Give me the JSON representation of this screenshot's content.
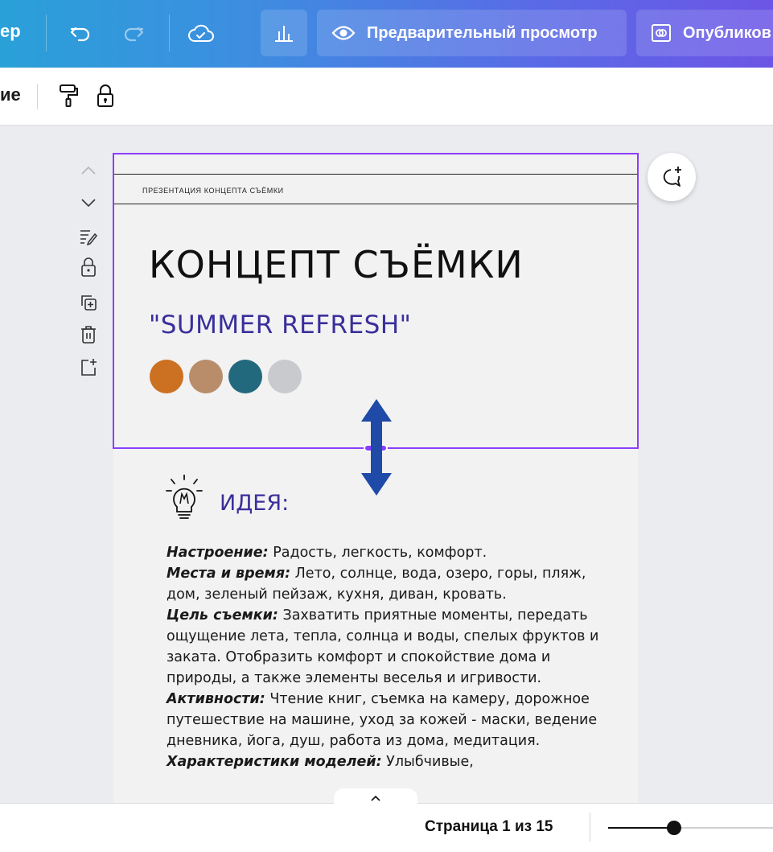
{
  "topbar": {
    "left_fragment": "ер",
    "preview_label": "Предварительный просмотр",
    "publish_label": "Опубликов",
    "icons": [
      "undo-icon",
      "redo-icon",
      "cloud-saved-icon",
      "insights-icon",
      "eye-icon",
      "publish-icon"
    ]
  },
  "toolbar": {
    "left_fragment": "ие",
    "icons": [
      "paint-roller-icon",
      "lock-icon"
    ]
  },
  "page_controls": [
    "chevron-up-icon",
    "chevron-down-icon",
    "notes-icon",
    "lock-icon",
    "duplicate-icon",
    "trash-icon",
    "add-page-icon"
  ],
  "page": {
    "caption": "ПРЕЗЕНТАЦИЯ КОНЦЕПТА СЪЁМКИ",
    "title": "КОНЦЕПТ СЪЁМКИ",
    "subtitle": "\"SUMMER REFRESH\"",
    "palette": [
      "#cc7022",
      "#b98d6a",
      "#23697e",
      "#c9cacd"
    ],
    "idea_heading": "ИДЕЯ:",
    "paragraphs": [
      {
        "label": "Настроение:",
        "text": " Радость, легкость, комфорт."
      },
      {
        "label": "Места и время:",
        "text": " Лето, солнце, вода, озеро, горы, пляж, дом, зеленый пейзаж, кухня, диван, кровать."
      },
      {
        "label": "Цель съемки:",
        "text": " Захватить приятные моменты, передать ощущение лета, тепла, солнца и воды, спелых фруктов и заката. Отобразить комфорт и спокойствие дома и природы, а также элементы веселья и игривости."
      },
      {
        "label": "Активности:",
        "text": " Чтение книг, съемка на камеру, дорожное путешествие на машине, уход за кожей - маски, ведение дневника, йога, душ, работа из дома, медитация."
      },
      {
        "label": "Характеристики моделей:",
        "text": " Улыбчивые,"
      }
    ]
  },
  "colors": {
    "selection": "#8b3dff",
    "arrow": "#1f4aa8",
    "accent_text": "#3a2f9a"
  },
  "bottombar": {
    "page_indicator": "Страница 1 из 15",
    "zoom_fraction": 0.4
  }
}
